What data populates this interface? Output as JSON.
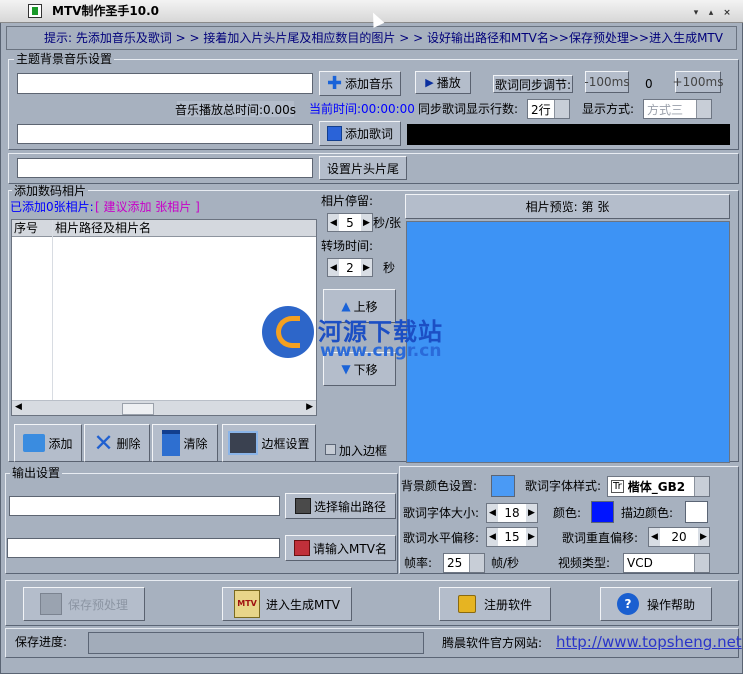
{
  "window": {
    "title": "MTV制作圣手10.0"
  },
  "hint": {
    "text": "提示: 先添加音乐及歌词 > > 接着加入片头片尾及相应数目的图片 > > 设好输出路径和MTV名>>保存预处理>>进入生成MTV"
  },
  "music": {
    "legend": "主题背景音乐设置",
    "add_music_label": "添加音乐",
    "play_label": "播放",
    "sync_label": "歌词同步调节:",
    "minus_label": "-100ms",
    "sync_value": "0",
    "plus_label": "+100ms",
    "total_time_label": "音乐播放总时间:0.00s",
    "current_time_label": "当前时间:00:00:00",
    "sync_lines_label": "同步歌词显示行数:",
    "sync_lines_value": "2行",
    "display_mode_label": "显示方式:",
    "display_mode_value": "方式三",
    "add_lyrics_label": "添加歌词",
    "set_header_label": "设置片头片尾"
  },
  "photos": {
    "legend": "添加数码相片",
    "count_text": "已添加0张相片:",
    "suggest_text": "[ 建议添加  张相片 ]",
    "col_index": "序号",
    "col_path": "相片路径及相片名",
    "stay_label": "相片停留:",
    "stay_value": "5",
    "stay_unit": "秒/张",
    "transition_label": "转场时间:",
    "transition_value": "2",
    "transition_unit": "秒",
    "up_label": "上移",
    "down_label": "下移",
    "preview_label": "相片预览: 第   张",
    "add_label": "添加",
    "delete_label": "删除",
    "clear_label": "清除",
    "border_label": "边框设置",
    "add_border_label": "加入边框"
  },
  "watermark": {
    "line1": "河源下载站",
    "line2": "www.cngr.cn"
  },
  "output": {
    "legend": "输出设置",
    "choose_path_label": "选择输出路径",
    "mtv_name_label": "请输入MTV名"
  },
  "style": {
    "bg_color_label": "背景颜色设置:",
    "font_style_label": "歌词字体样式:",
    "font_style_value": "楷体_GB2",
    "font_size_label": "歌词字体大小:",
    "font_size_value": "18",
    "color_label": "颜色:",
    "stroke_color_label": "描边颜色:",
    "h_offset_label": "歌词水平偏移:",
    "h_offset_value": "15",
    "overlap_offset_label": "歌词重直偏移:",
    "overlap_offset_value": "20",
    "fps_label": "帧率:",
    "fps_value": "25",
    "fps_unit": "帧/秒",
    "video_type_label": "视频类型:",
    "video_type_value": "VCD",
    "bg_color": "#4a9af5",
    "lyric_color": "#0014ff",
    "stroke_color": "#ffffff"
  },
  "actions": {
    "save_label": "保存预处理",
    "generate_label": "进入生成MTV",
    "register_label": "注册软件",
    "help_label": "操作帮助"
  },
  "footer": {
    "progress_label": "保存进度:",
    "site_label": "腾晨软件官方网站:",
    "site_url": "http://www.topsheng.net"
  }
}
